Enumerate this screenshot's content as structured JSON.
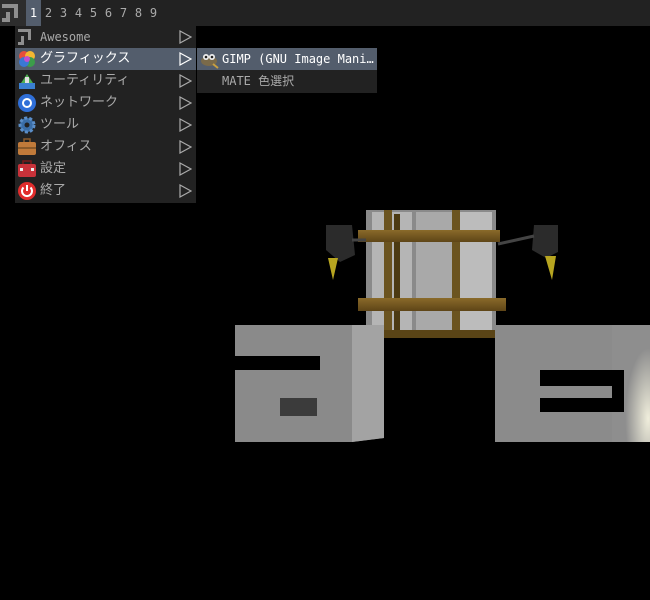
{
  "wibar": {
    "tags": [
      "1",
      "2",
      "3",
      "4",
      "5",
      "6",
      "7",
      "8",
      "9"
    ],
    "active_tag": 0
  },
  "menu": {
    "items": [
      {
        "label": "Awesome",
        "icon": "awesome-icon"
      },
      {
        "label": "グラフィックス",
        "icon": "graphics-icon"
      },
      {
        "label": "ユーティリティ",
        "icon": "utilities-icon"
      },
      {
        "label": "ネットワーク",
        "icon": "network-icon"
      },
      {
        "label": "ツール",
        "icon": "tools-gear-icon"
      },
      {
        "label": "オフィス",
        "icon": "office-briefcase-icon"
      },
      {
        "label": "設定",
        "icon": "settings-toolbox-icon"
      },
      {
        "label": "終了",
        "icon": "power-icon"
      }
    ],
    "focused_index": 1
  },
  "submenu": {
    "items": [
      {
        "label": "GIMP (GNU Image Mani…",
        "icon": "gimp-icon"
      },
      {
        "label": "MATE 色選択",
        "icon": ""
      }
    ]
  },
  "colors": {
    "bar_bg": "#222222",
    "focus_bg": "#535d6c",
    "text_normal": "#aaaaaa",
    "text_focus": "#ffffff",
    "wallpaper_bg": "#000000"
  }
}
